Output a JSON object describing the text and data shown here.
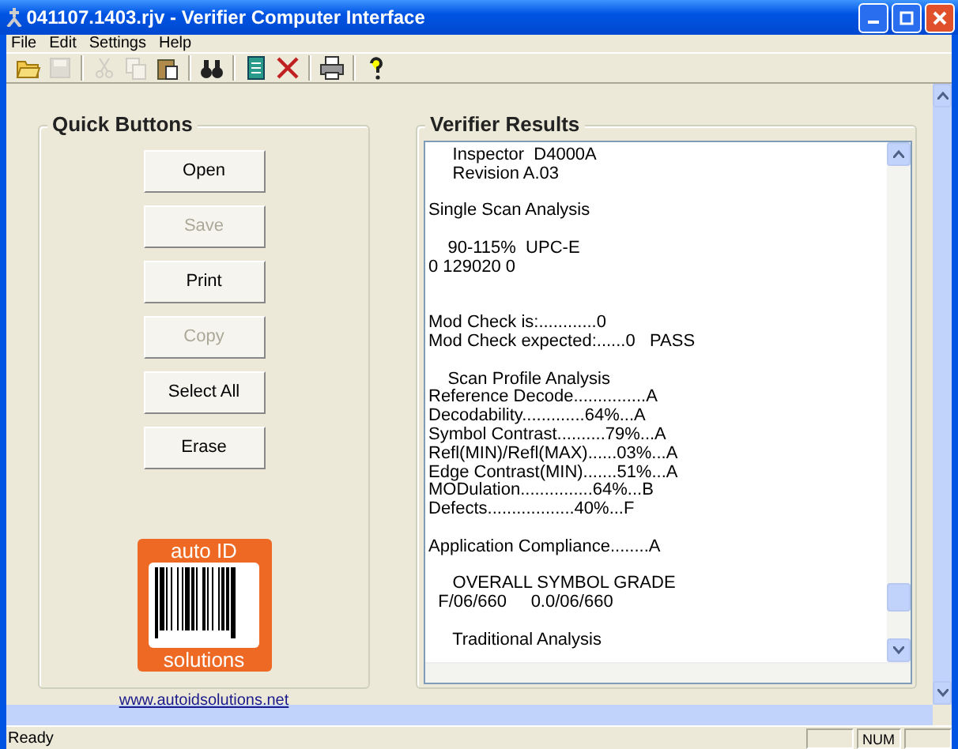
{
  "window": {
    "title": "041107.1403.rjv - Verifier Computer Interface"
  },
  "menu": [
    "File",
    "Edit",
    "Settings",
    "Help"
  ],
  "toolbar": [
    [
      {
        "disabled": false
      },
      {
        "disabled": true
      }
    ],
    [
      {
        "disabled": true
      },
      {
        "disabled": true
      },
      {
        "disabled": false
      }
    ],
    [
      {
        "disabled": false
      }
    ],
    [
      {
        "disabled": false
      },
      {
        "disabled": false
      }
    ],
    [
      {
        "disabled": false
      }
    ],
    [
      {
        "disabled": false
      }
    ]
  ],
  "quick_buttons": {
    "title": "Quick Buttons",
    "buttons": [
      {
        "label": "Open",
        "disabled": false
      },
      {
        "label": "Save",
        "disabled": true
      },
      {
        "label": "Print",
        "disabled": false
      },
      {
        "label": "Copy",
        "disabled": true
      },
      {
        "label": "Select All",
        "disabled": false
      },
      {
        "label": "Erase",
        "disabled": false
      }
    ],
    "logo": {
      "top": "auto ID",
      "bottom": "solutions"
    },
    "link": "www.autoidsolutions.net"
  },
  "verifier_results": {
    "title": "Verifier Results",
    "lines": [
      {
        "kind": "text",
        "text": "     Inspector  D4000A"
      },
      {
        "kind": "text",
        "text": "     Revision A.03"
      },
      {
        "kind": "blank"
      },
      {
        "kind": "text",
        "text": "Single Scan Analysis"
      },
      {
        "kind": "blank"
      },
      {
        "kind": "text",
        "text": "    90-115%  UPC-E"
      },
      {
        "kind": "text",
        "text": "0 129020 0"
      },
      {
        "kind": "blank"
      },
      {
        "kind": "blank"
      },
      {
        "kind": "text",
        "text": "Mod Check is:............0"
      },
      {
        "kind": "text",
        "text": "Mod Check expected:......0   PASS"
      },
      {
        "kind": "blank"
      },
      {
        "kind": "text",
        "text": "    Scan Profile Analysis"
      },
      {
        "kind": "text",
        "text": "Reference Decode...............A"
      },
      {
        "kind": "text",
        "text": "Decodability.............64%...A"
      },
      {
        "kind": "text",
        "text": "Symbol Contrast..........79%...A"
      },
      {
        "kind": "text",
        "text": "Refl(MIN)/Refl(MAX)......03%...A"
      },
      {
        "kind": "text",
        "text": "Edge Contrast(MIN).......51%...A"
      },
      {
        "kind": "text",
        "text": "MODulation...............64%...B"
      },
      {
        "kind": "text",
        "text": "Defects..................40%...F"
      },
      {
        "kind": "blank"
      },
      {
        "kind": "text",
        "text": "Application Compliance........A"
      },
      {
        "kind": "blank"
      },
      {
        "kind": "text",
        "text": "     OVERALL SYMBOL GRADE"
      },
      {
        "kind": "text",
        "text": "  F/06/660     0.0/06/660"
      },
      {
        "kind": "blank"
      },
      {
        "kind": "text",
        "text": "     Traditional Analysis"
      }
    ]
  },
  "status_bar": {
    "text": "Ready",
    "panes": [
      "NUM"
    ]
  }
}
